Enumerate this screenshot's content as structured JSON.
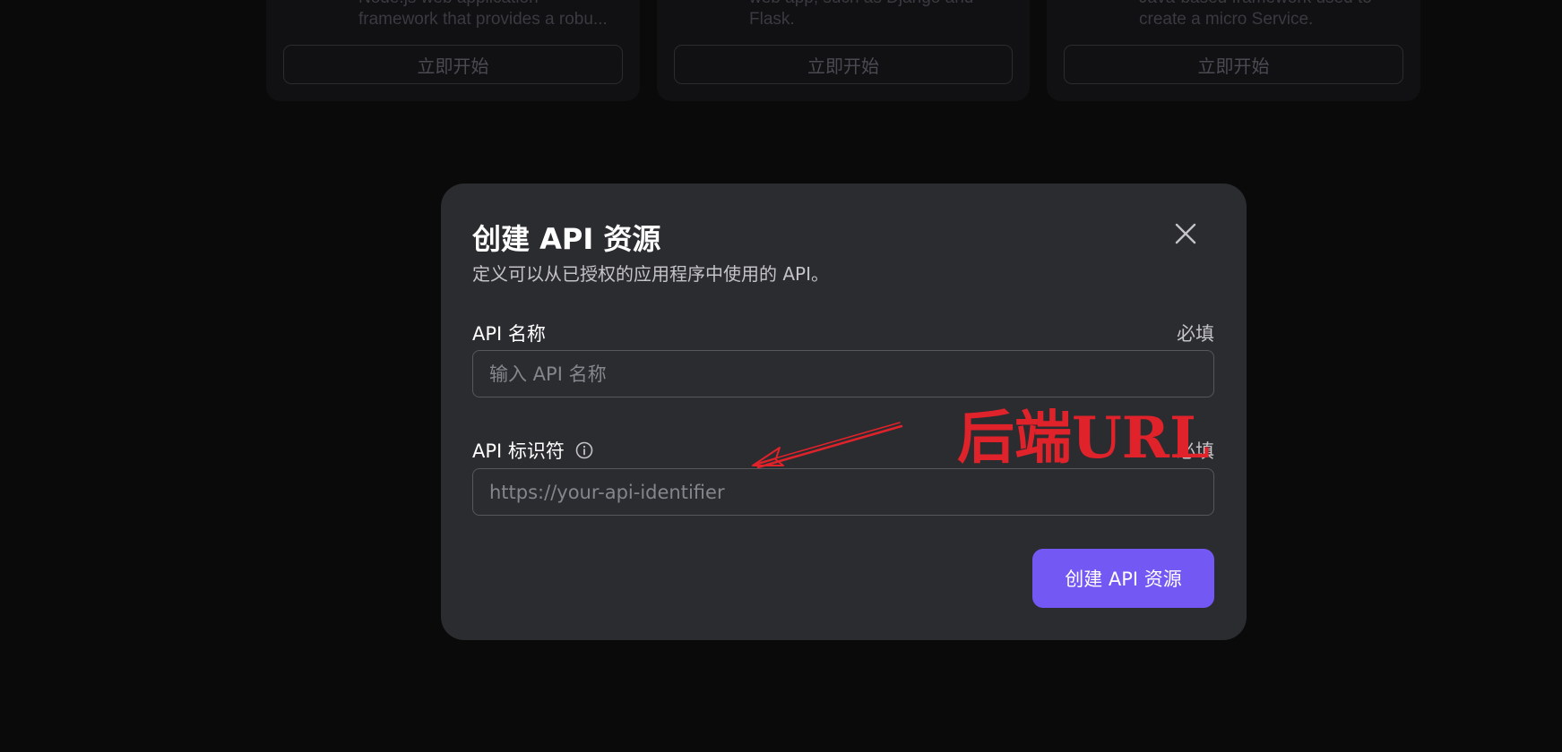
{
  "background_cards": [
    {
      "desc_lines": [
        "Node.js web application",
        "framework that provides a robu..."
      ],
      "button_label": "立即开始"
    },
    {
      "desc_lines": [
        "web app, such as Django and",
        "Flask."
      ],
      "button_label": "立即开始"
    },
    {
      "desc_lines": [
        "Java-based framework used to",
        "create a micro Service."
      ],
      "button_label": "立即开始"
    }
  ],
  "modal": {
    "title": "创建 API 资源",
    "subtitle": "定义可以从已授权的应用程序中使用的 API。",
    "fields": [
      {
        "label": "API 名称",
        "required": "必填",
        "placeholder": "输入 API 名称",
        "value": ""
      },
      {
        "label": "API 标识符",
        "required": "必填",
        "placeholder": "https://your-api-identifier",
        "value": "",
        "info_icon": "info-circle-icon"
      }
    ],
    "submit_label": "创建 API 资源",
    "close_icon": "close-icon"
  },
  "annotation": {
    "text": "后端URL",
    "color": "#e0222a"
  },
  "colors": {
    "accent": "#7458f3",
    "modal_bg": "#2b2c30",
    "page_bg": "#0a0a0b"
  }
}
